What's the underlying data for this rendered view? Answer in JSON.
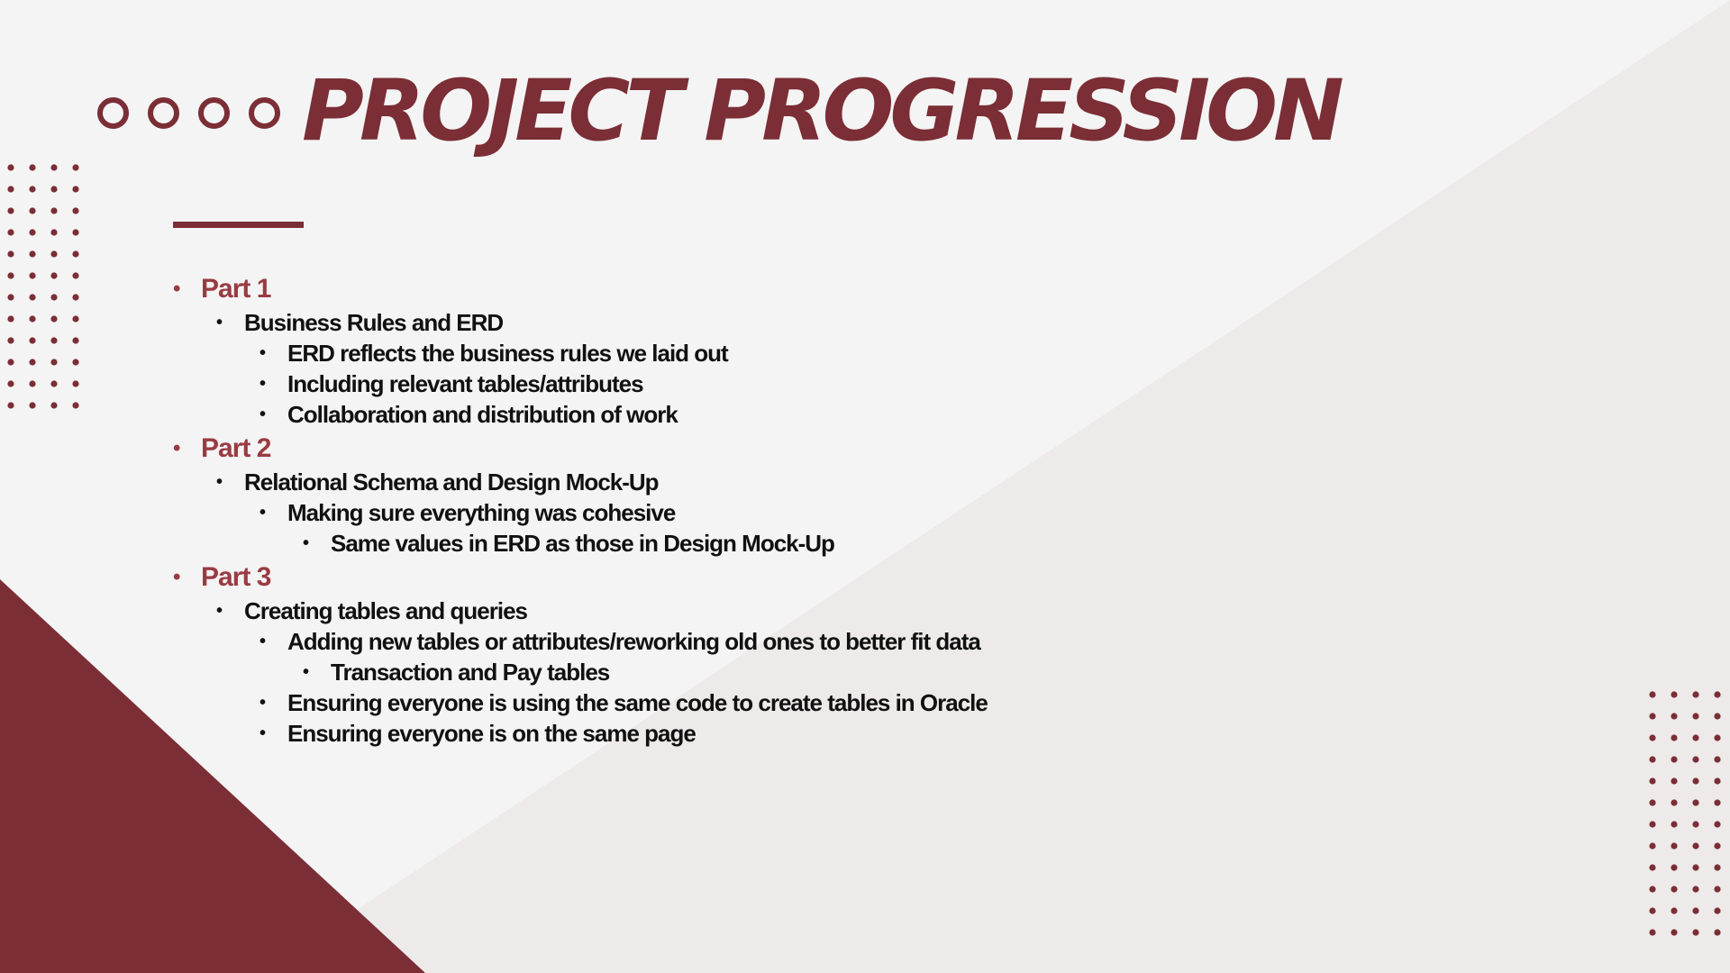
{
  "slide": {
    "title": "PROJECT PROGRESSION",
    "accent_color": "#7b2e35",
    "background_color": "#f4f4f4",
    "outline": [
      {
        "level": 0,
        "text": "Part 1"
      },
      {
        "level": 1,
        "text": "Business Rules and ERD"
      },
      {
        "level": 2,
        "text": "ERD reflects the business rules we laid out"
      },
      {
        "level": 2,
        "text": "Including relevant tables/attributes"
      },
      {
        "level": 2,
        "text": "Collaboration and distribution of work"
      },
      {
        "level": 0,
        "text": "Part 2"
      },
      {
        "level": 1,
        "text": "Relational Schema and Design Mock-Up"
      },
      {
        "level": 2,
        "text": "Making sure everything was cohesive"
      },
      {
        "level": 3,
        "text": "Same values in ERD as those in Design Mock-Up"
      },
      {
        "level": 0,
        "text": "Part 3"
      },
      {
        "level": 1,
        "text": "Creating tables and queries"
      },
      {
        "level": 2,
        "text": "Adding new tables or attributes/reworking old ones to better fit data"
      },
      {
        "level": 3,
        "text": "Transaction and Pay tables"
      },
      {
        "level": 2,
        "text": "Ensuring everyone is using the same code to create tables in Oracle"
      },
      {
        "level": 2,
        "text": "Ensuring everyone is on the same page"
      }
    ]
  }
}
